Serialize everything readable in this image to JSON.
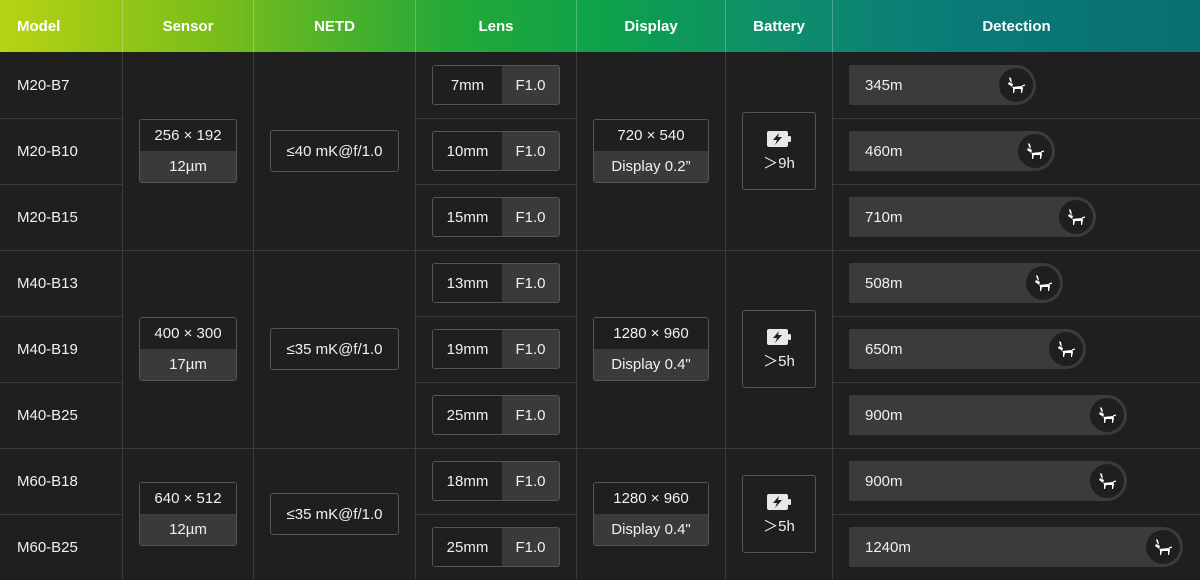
{
  "headers": [
    "Model",
    "Sensor",
    "NETD",
    "Lens",
    "Display",
    "Battery",
    "Detection"
  ],
  "models": [
    "M20-B7",
    "M20-B10",
    "M20-B15",
    "M40-B13",
    "M40-B19",
    "M40-B25",
    "M60-B18",
    "M60-B25"
  ],
  "groups": [
    {
      "sensor_res": "256 × 192",
      "sensor_pitch": "12µm",
      "netd": "≤40 mK@f/1.0",
      "display_res": "720 × 540",
      "display_size": "Display 0.2”",
      "battery": "＞9h"
    },
    {
      "sensor_res": "400 × 300",
      "sensor_pitch": "17µm",
      "netd": "≤35 mK@f/1.0",
      "display_res": "1280 × 960",
      "display_size": "Display 0.4\"",
      "battery": "＞5h"
    },
    {
      "sensor_res": "640 × 512",
      "sensor_pitch": "12µm",
      "netd": "≤35 mK@f/1.0",
      "display_res": "1280 × 960",
      "display_size": "Display 0.4\"",
      "battery": "＞5h"
    }
  ],
  "lenses": [
    {
      "mm": "7mm",
      "f": "F1.0"
    },
    {
      "mm": "10mm",
      "f": "F1.0"
    },
    {
      "mm": "15mm",
      "f": "F1.0"
    },
    {
      "mm": "13mm",
      "f": "F1.0"
    },
    {
      "mm": "19mm",
      "f": "F1.0"
    },
    {
      "mm": "25mm",
      "f": "F1.0"
    },
    {
      "mm": "18mm",
      "f": "F1.0"
    },
    {
      "mm": "25mm",
      "f": "F1.0"
    }
  ],
  "detection": [
    {
      "label": "345m",
      "meters": 345
    },
    {
      "label": "460m",
      "meters": 460
    },
    {
      "label": "710m",
      "meters": 710
    },
    {
      "label": "508m",
      "meters": 508
    },
    {
      "label": "650m",
      "meters": 650
    },
    {
      "label": "900m",
      "meters": 900
    },
    {
      "label": "900m",
      "meters": 900
    },
    {
      "label": "1240m",
      "meters": 1240
    }
  ],
  "icons": {
    "detection": "deer-icon",
    "battery": "battery-charging-icon"
  }
}
